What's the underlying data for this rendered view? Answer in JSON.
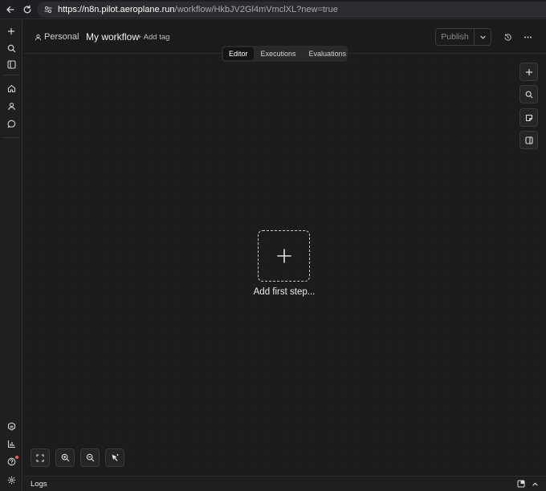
{
  "browser": {
    "url_host": "https://n8n.pilot.aeroplane.run",
    "url_path": "/workflow/HkbJV2Gl4mVmclXL?new=true"
  },
  "header": {
    "project": "Personal",
    "workflow_name": "My workflow",
    "add_tag": "+ Add tag",
    "publish_label": "Publish"
  },
  "tabs": [
    {
      "label": "Editor",
      "active": true
    },
    {
      "label": "Executions",
      "active": false
    },
    {
      "label": "Evaluations",
      "active": false
    }
  ],
  "canvas": {
    "add_first_step": "Add first step..."
  },
  "logs": {
    "label": "Logs"
  },
  "colors": {
    "background": "#1c1c1c",
    "notification_dot": "#ff5a5a"
  }
}
